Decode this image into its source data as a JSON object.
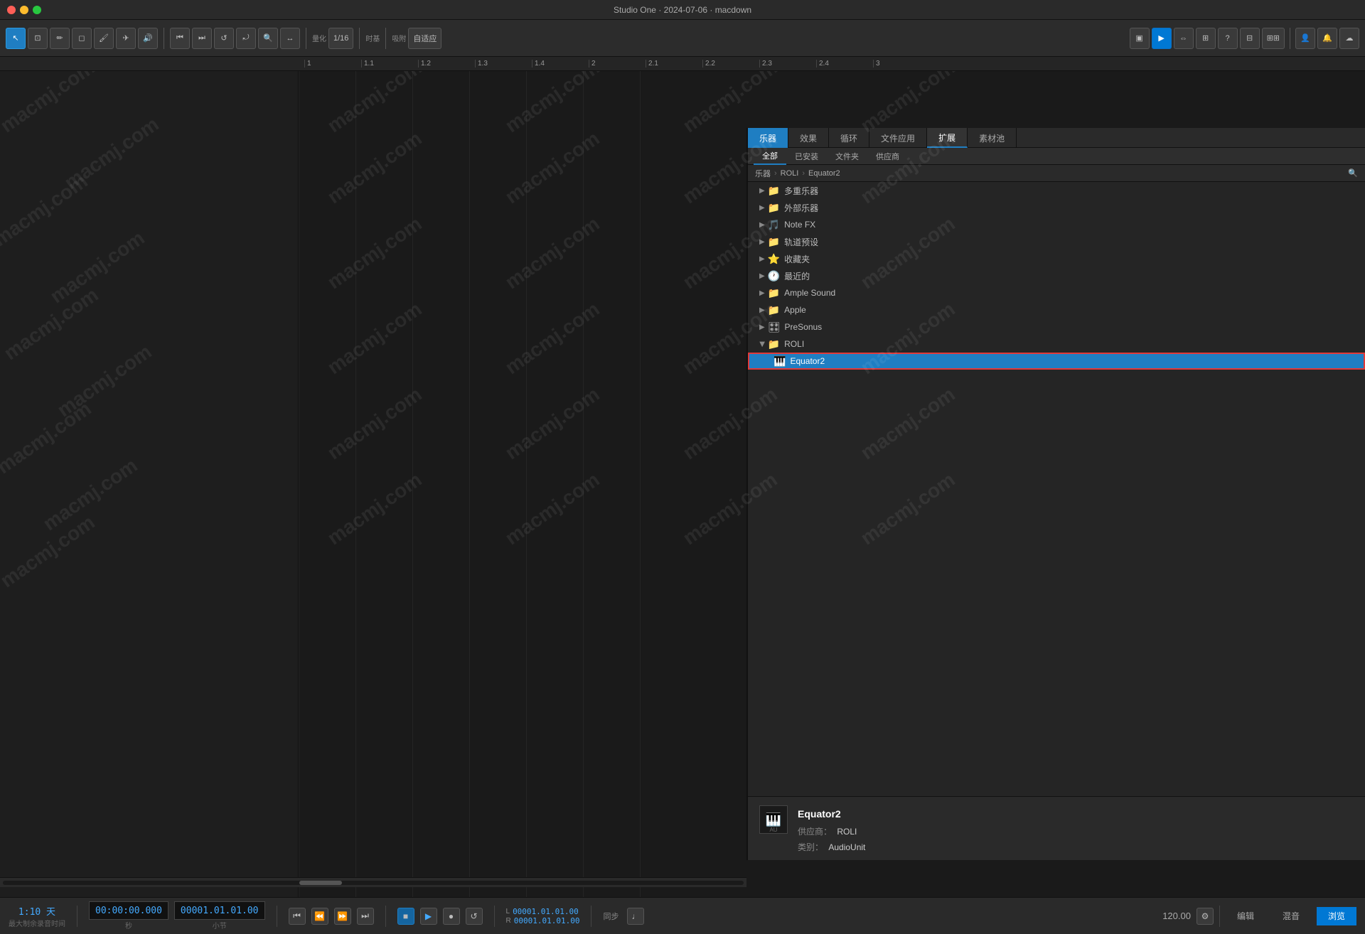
{
  "window": {
    "title": "Studio One · 2024-07-06 · macdown"
  },
  "toolbar": {
    "quantize_label": "量化",
    "quantize_value": "1/16",
    "timebase_label": "时基",
    "snap_label": "吸附",
    "snap_value": "自适应",
    "tempo_label": "120.00"
  },
  "tabs": {
    "instruments": "乐器",
    "effects": "效果",
    "loops": "循环",
    "files": "文件应用",
    "extensions": "扩展",
    "pool": "素材池"
  },
  "subtabs": {
    "all": "全部",
    "installed": "已安装",
    "files": "文件夹",
    "vendor": "供应商"
  },
  "breadcrumb": {
    "root": "乐器",
    "sep1": "›",
    "folder": "ROLI",
    "sep2": "›",
    "item": "Equator2"
  },
  "browser_list": {
    "items": [
      {
        "type": "folder",
        "label": "多重乐器",
        "indent": 1,
        "expanded": false
      },
      {
        "type": "folder",
        "label": "外部乐器",
        "indent": 1,
        "expanded": false
      },
      {
        "type": "folder",
        "label": "Note FX",
        "indent": 1,
        "expanded": false
      },
      {
        "type": "folder",
        "label": "轨道预设",
        "indent": 1,
        "expanded": false
      },
      {
        "type": "folder",
        "label": "收藏夹",
        "indent": 1,
        "expanded": false
      },
      {
        "type": "folder",
        "label": "最近的",
        "indent": 1,
        "expanded": false
      },
      {
        "type": "folder",
        "label": "Ample Sound",
        "indent": 1,
        "expanded": false
      },
      {
        "type": "folder",
        "label": "Apple",
        "indent": 1,
        "expanded": false
      },
      {
        "type": "folder",
        "label": "PreSonus",
        "indent": 1,
        "expanded": false
      },
      {
        "type": "folder",
        "label": "ROLI",
        "indent": 1,
        "expanded": true
      },
      {
        "type": "instrument",
        "label": "Equator2",
        "indent": 2,
        "selected": true
      }
    ]
  },
  "info_panel": {
    "name": "Equator2",
    "vendor_label": "供应商：",
    "vendor": "ROLI",
    "category_label": "类别：",
    "category": "AudioUnit"
  },
  "transport": {
    "time_display": "1:10 天",
    "time_label": "最大制余录音时间",
    "timecode": "00:00:00.000",
    "timecode_unit": "秒",
    "bars": "00001.01.01.00",
    "bars_unit": "小节",
    "pos1": "00001.01.01.00",
    "pos2": "00001.01.01.00",
    "sync": "同步",
    "tempo": "120.00",
    "edit_label": "编辑",
    "mix_label": "混音",
    "browse_label": "浏览"
  },
  "ruler": {
    "marks": [
      "1",
      "1.1",
      "1.2",
      "1.3",
      "1.4",
      "2",
      "2.1",
      "2.2",
      "2.3",
      "2.4",
      "3"
    ]
  },
  "watermarks": [
    "macmj.com",
    "macmj.com",
    "macmj.com"
  ],
  "icons": {
    "folder": "📁",
    "instrument": "🎹",
    "presonus": "🎛",
    "search": "🔍",
    "piano": "🎹"
  }
}
